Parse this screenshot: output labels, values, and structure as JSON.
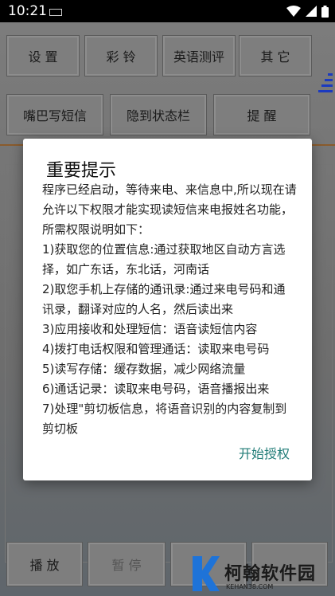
{
  "status_bar": {
    "time": "10:21"
  },
  "buttons_row1": [
    "设 置",
    "彩 铃",
    "英语测评",
    "其 它"
  ],
  "buttons_row2": [
    "嘴巴写短信",
    "隐到状态栏",
    "提 醒"
  ],
  "bottom_buttons": [
    "播 放",
    "暂 停"
  ],
  "dialog": {
    "title": "重要提示",
    "body_lines": [
      "程序已经启动，等待来电、来信息中,所以现在请允许以下权限才能实现读短信来电报姓名功能，所需权限说明如下：",
      "1)获取您的位置信息:通过获取地区自动方言选择，如广东话，东北话，河南话",
      "2)取您手机上存储的通讯录:通过来电号码和通讯录，翻译对应的人名，然后读出来",
      "3)应用接收和处理短信：语音读短信内容",
      "4)拨打电话权限和管理通话：读取来电号码",
      "5)读写存储：缓存数据，减少网络流量",
      "6)通话记录：读取来电号码，语音播报出来",
      "7)处理\"剪切板信息，将语音识别的内容复制到剪切板"
    ],
    "action_label": "开始授权"
  },
  "watermark": {
    "name": "柯翰软件园",
    "url": "KEHAN38.COM"
  }
}
